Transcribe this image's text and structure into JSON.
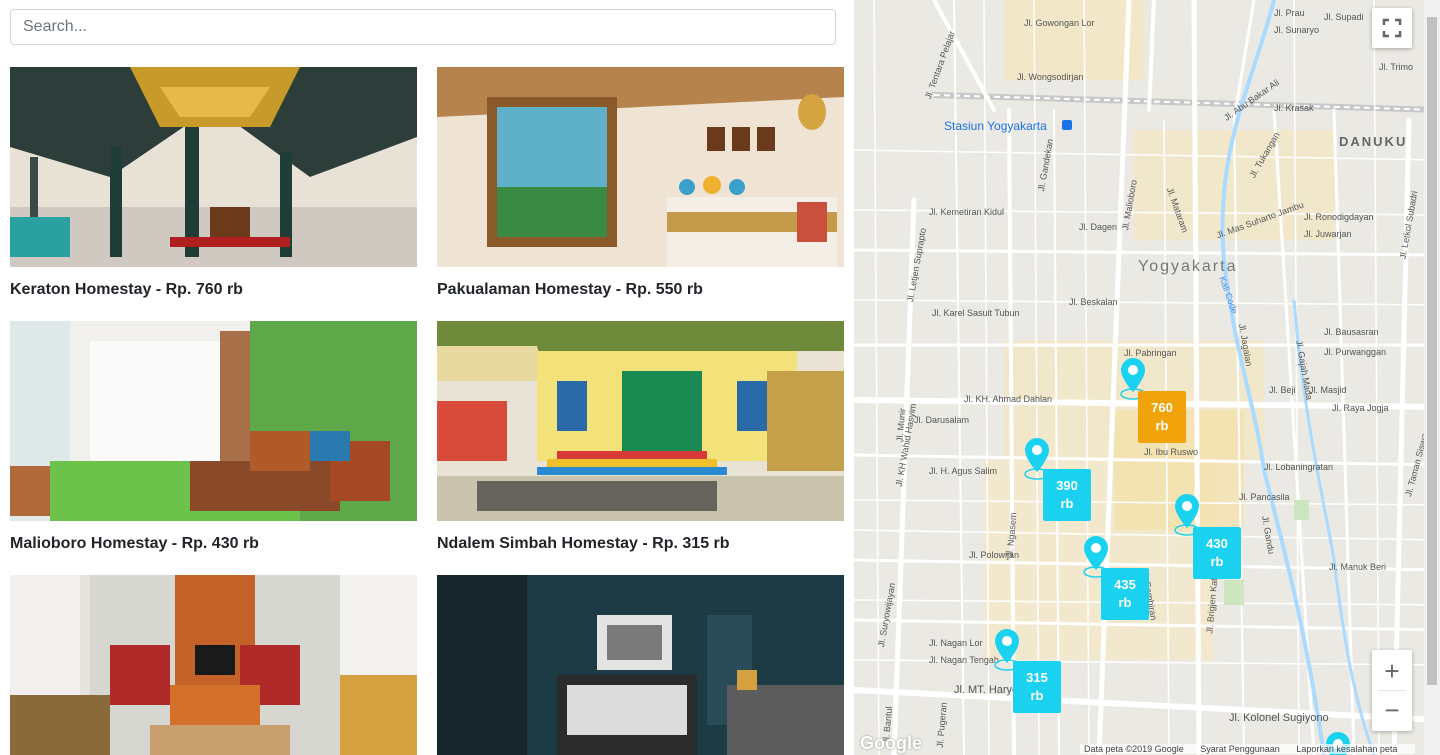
{
  "search": {
    "placeholder": "Search..."
  },
  "listings": [
    {
      "title": "Keraton Homestay - Rp. 760 rb"
    },
    {
      "title": "Pakualaman Homestay - Rp. 550 rb"
    },
    {
      "title": "Malioboro Homestay - Rp. 430 rb"
    },
    {
      "title": "Ndalem Simbah Homestay - Rp. 315 rb"
    },
    {
      "title": ""
    },
    {
      "title": ""
    }
  ],
  "map": {
    "city_label": "Yogyakarta",
    "station_label": "Stasiun Yogyakarta",
    "district_label": "DANUKU",
    "river_label": "Kali Code",
    "streets": [
      "Jl. Tentara Pelajar",
      "Jl. Gowongan Lor",
      "Jl. Wongsodirjan",
      "Jl. Abu Bakar Ali",
      "Jl. Trimo",
      "Jl. Krasak",
      "Jl. Kemetiran Kidul",
      "Jl. Malioboro",
      "Jl. Mataram",
      "Jl. Mas Suharto Jambu",
      "Jl. Ronodigdayan",
      "Jl. Juwarjan",
      "Jl. Letjen Suprapto",
      "Jl. Karel Sasuit Tubun",
      "Jl. Beskalan",
      "Jl. Pabringan",
      "Jl. KH. Ahmad Dahlan",
      "Jl. Raya Jogja",
      "Jl. Ibu Ruswo",
      "Jl. H. Agus Salim",
      "Jl. Lobaningratan",
      "Jl. Pancasila",
      "Jl. Polowijan",
      "Jl. Nagan Lor",
      "Jl. Nagan Tengah",
      "Jl. MT. Haryono",
      "Jl. Kolonel Sugiyono",
      "Jl. KH Wahid Hasyim",
      "Jl. Suryowijayan",
      "Jl. Brigjen Katamso",
      "Jl. Bausasran",
      "Jl. Purwanggan",
      "Jl. Letkol Subadri",
      "Jl. Taman Siswa",
      "Jl. Gandekan",
      "Jl. Dagen",
      "Jl. Darusalam",
      "Jl. Supadi",
      "Jl. Sunaryo",
      "Jl. Prau",
      "Jl. Gajah Mada",
      "Jl. Masjid",
      "Jl. Beji",
      "Jl. Manuk Beri",
      "Jl. Tukangan",
      "Jl. Jagalan",
      "Jl. Gambiran",
      "Jl. Gandu",
      "Jl. Ngasem",
      "Jl. Pugeran",
      "Jl. Bantul",
      "Jl. Munir"
    ],
    "markers": [
      {
        "price": "760 rb",
        "color": "#f0a30a"
      },
      {
        "price": "390 rb",
        "color": "#1ad1f0"
      },
      {
        "price": "430 rb",
        "color": "#1ad1f0"
      },
      {
        "price": "435 rb",
        "color": "#1ad1f0"
      },
      {
        "price": "315 rb",
        "color": "#1ad1f0"
      }
    ],
    "zoom_in": "+",
    "zoom_out": "−",
    "fullscreen": "⛶",
    "attribution": {
      "data": "Data peta ©2019 Google",
      "terms": "Syarat Penggunaan",
      "report": "Laporkan kesalahan peta"
    },
    "logo": "Google"
  }
}
